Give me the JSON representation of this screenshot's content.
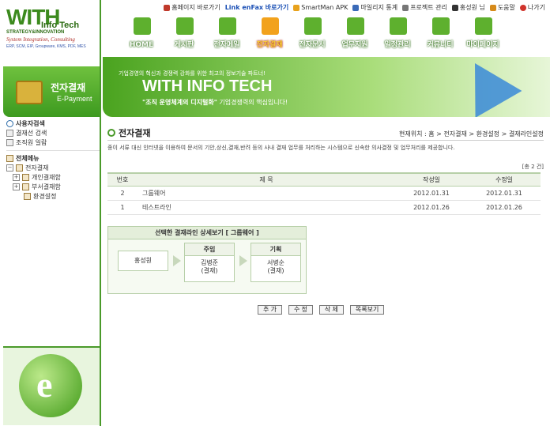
{
  "brand": {
    "logo_with": "WITH",
    "logo_sub": "Info Tech",
    "logo_tagline": "STRATEGY&INNOVATION",
    "logo_si": "System Integration, Consulting",
    "logo_products": "ERP, SCM, EIP, Groupware, KMS, PDF, MES"
  },
  "toplinks": [
    {
      "label": "홈페이지 바로가기"
    },
    {
      "label": "Link enFax 바로가기"
    },
    {
      "label": "SmartMan APK"
    },
    {
      "label": "마일리지 통계"
    },
    {
      "label": "프로젝트 관리"
    },
    {
      "label": "홍성원 님"
    },
    {
      "label": "도움말"
    },
    {
      "label": "나가기"
    }
  ],
  "nav": [
    {
      "label": "HOME"
    },
    {
      "label": "게시판"
    },
    {
      "label": "전자메일"
    },
    {
      "label": "전자결재"
    },
    {
      "label": "전자문서"
    },
    {
      "label": "업무지원"
    },
    {
      "label": "일정관리"
    },
    {
      "label": "커뮤니티"
    },
    {
      "label": "마이페이지"
    }
  ],
  "banner": {
    "sub": "기업경영의 혁신과 경쟁력 강화를 위한 최고의 정보기술 파트너!",
    "headline": "WITH INFO TECH",
    "tag_bold": "\"조직 운영체계의 디지털화\"",
    "tag_rest": " 기업경쟁력의 핵심입니다!"
  },
  "side": {
    "title": "전자결재",
    "sub": "E-Payment",
    "search_head": "사용자검색",
    "search_items": [
      "결재선 검색",
      "조직원 일람"
    ],
    "menu_head": "전체메뉴",
    "tree": [
      {
        "label": "전자결재",
        "level": 1
      },
      {
        "label": "개인결재함",
        "level": 2
      },
      {
        "label": "부서결재함",
        "level": 2
      },
      {
        "label": "환경설정",
        "level": 3
      }
    ]
  },
  "page": {
    "title": "전자결재",
    "breadcrumb": "현재위치 : 홈 > 전자결재 > 환경설정 > 결재라인설정",
    "description": "종이 서류 대신 인터넷을 이용하여 문서의 기안,상신,결재,반려 등의 사내 결재 업무를 처리하는 시스템으로 신속한 의사결정 및 업무처리를 제공합니다.",
    "total": "[총 2 건]"
  },
  "table": {
    "headers": {
      "no": "번호",
      "title": "제 목",
      "created": "작성일",
      "modified": "수정일"
    },
    "rows": [
      {
        "no": "2",
        "title": "그룹웨어",
        "created": "2012.01.31",
        "modified": "2012.01.31"
      },
      {
        "no": "1",
        "title": "테스트라인",
        "created": "2012.01.26",
        "modified": "2012.01.26"
      }
    ]
  },
  "detail": {
    "header": "선택한 결재라인 상세보기 [ 그룹웨어 ]",
    "nodes": [
      {
        "role": "",
        "name": "홍성원",
        "type": ""
      },
      {
        "role": "주임",
        "name": "김병준",
        "type": "(결재)"
      },
      {
        "role": "기획",
        "name": "서병순",
        "type": "(결재)"
      }
    ]
  },
  "buttons": {
    "add": "추 가",
    "edit": "수 정",
    "delete": "삭 제",
    "list": "목록보기"
  }
}
